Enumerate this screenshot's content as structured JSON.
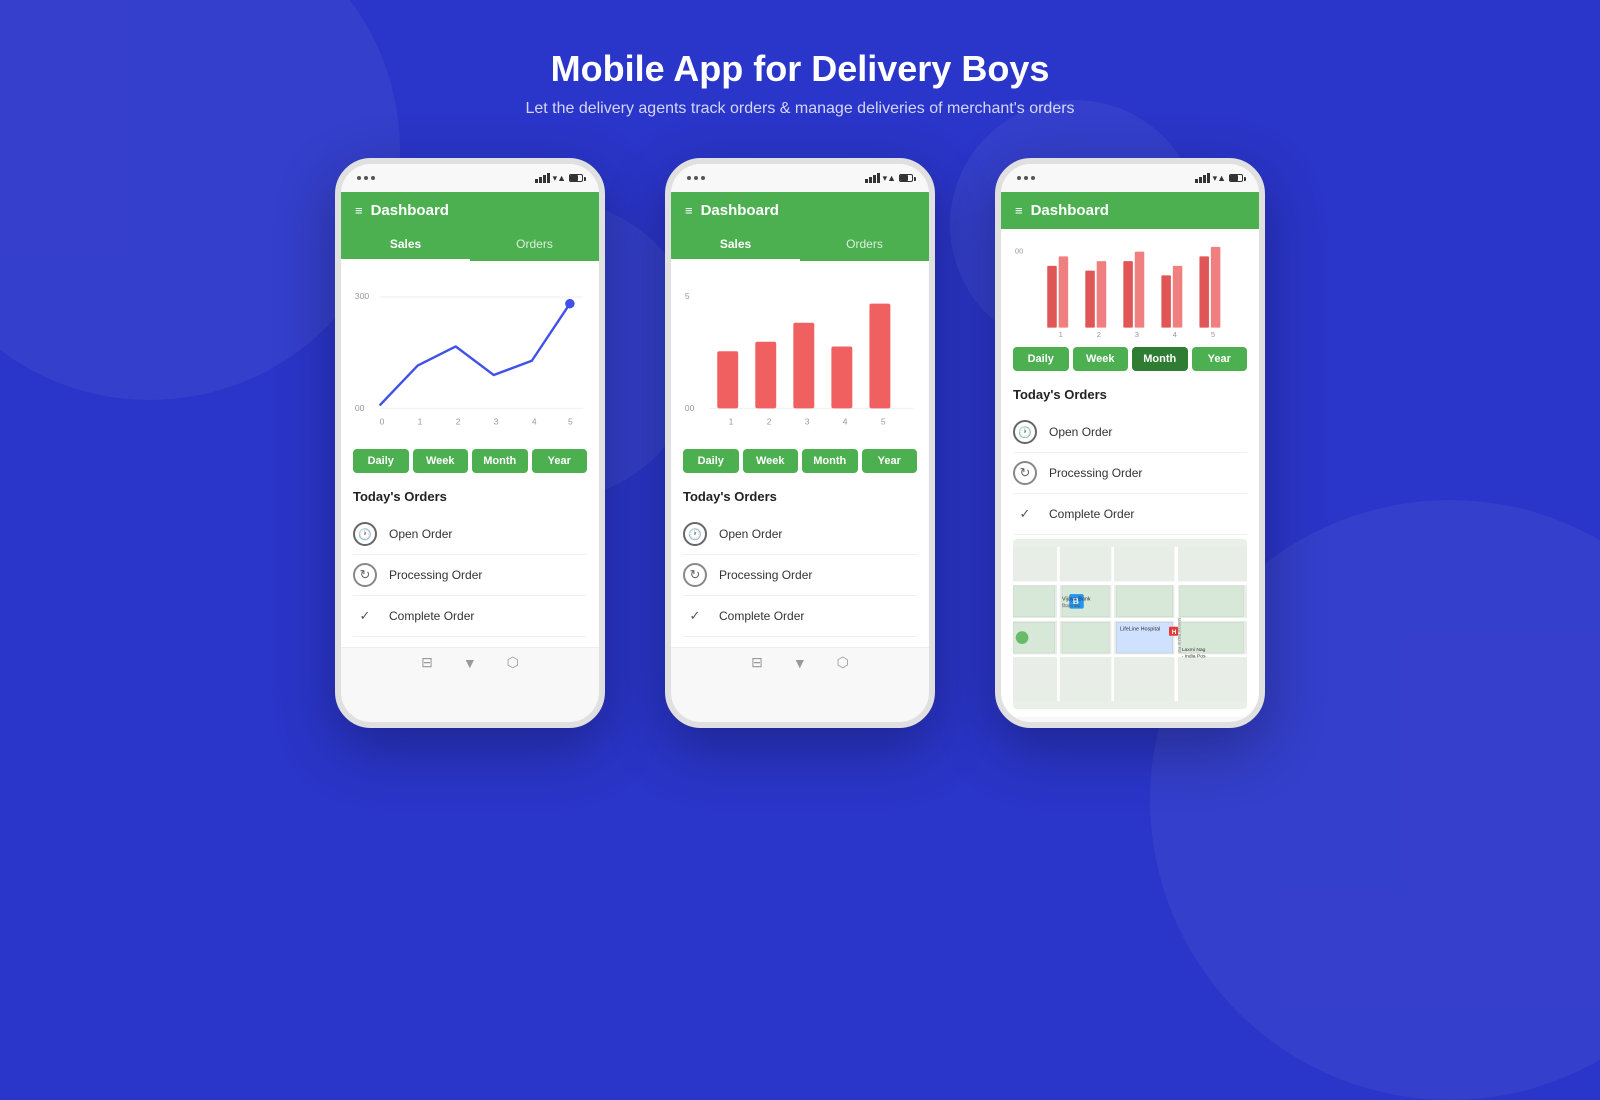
{
  "page": {
    "background_color": "#2a35c9",
    "title": "Mobile App for Delivery Boys",
    "subtitle": "Let the delivery agents track orders & manage deliveries of merchant's orders"
  },
  "phones": [
    {
      "id": "phone1",
      "chart_type": "line",
      "header": "Dashboard",
      "tabs": [
        "Sales",
        "Orders"
      ],
      "active_tab": "Sales",
      "y_labels": [
        "300",
        "00"
      ],
      "x_labels": [
        "0",
        "1",
        "2",
        "3",
        "4",
        "5"
      ],
      "period_buttons": [
        "Daily",
        "Week",
        "Month",
        "Year"
      ],
      "orders_title": "Today's Orders",
      "order_items": [
        {
          "label": "Open Order",
          "icon": "clock"
        },
        {
          "label": "Processing Order",
          "icon": "refresh"
        },
        {
          "label": "Complete Order",
          "icon": "check"
        }
      ]
    },
    {
      "id": "phone2",
      "chart_type": "bar",
      "header": "Dashboard",
      "tabs": [
        "Sales",
        "Orders"
      ],
      "active_tab": "Sales",
      "y_labels": [
        "5",
        "00"
      ],
      "x_labels": [
        "1",
        "2",
        "3",
        "4",
        "5"
      ],
      "period_buttons": [
        "Daily",
        "Week",
        "Month",
        "Year"
      ],
      "orders_title": "Today's Orders",
      "order_items": [
        {
          "label": "Open Order",
          "icon": "clock"
        },
        {
          "label": "Processing Order",
          "icon": "refresh"
        },
        {
          "label": "Complete Order",
          "icon": "check"
        }
      ]
    },
    {
      "id": "phone3",
      "chart_type": "bar_horizontal",
      "header": "Dashboard",
      "tabs": [],
      "x_labels": [
        "1",
        "2",
        "3",
        "4",
        "5"
      ],
      "period_buttons": [
        "Daily",
        "Week",
        "Month",
        "Year"
      ],
      "active_period": "Month",
      "orders_title": "Today's Orders",
      "order_items": [
        {
          "label": "Open Order",
          "icon": "clock"
        },
        {
          "label": "Processing Order",
          "icon": "refresh"
        },
        {
          "label": "Complete Order",
          "icon": "check"
        }
      ],
      "map_labels": [
        "Vijaya Bank",
        "LifeLine Hospital",
        "Laxmi Nag - India Pos"
      ]
    }
  ],
  "icons": {
    "hamburger": "≡",
    "clock": "🕐",
    "refresh": "↻",
    "check": "✓",
    "wifi": "▲",
    "signal": "◼"
  }
}
